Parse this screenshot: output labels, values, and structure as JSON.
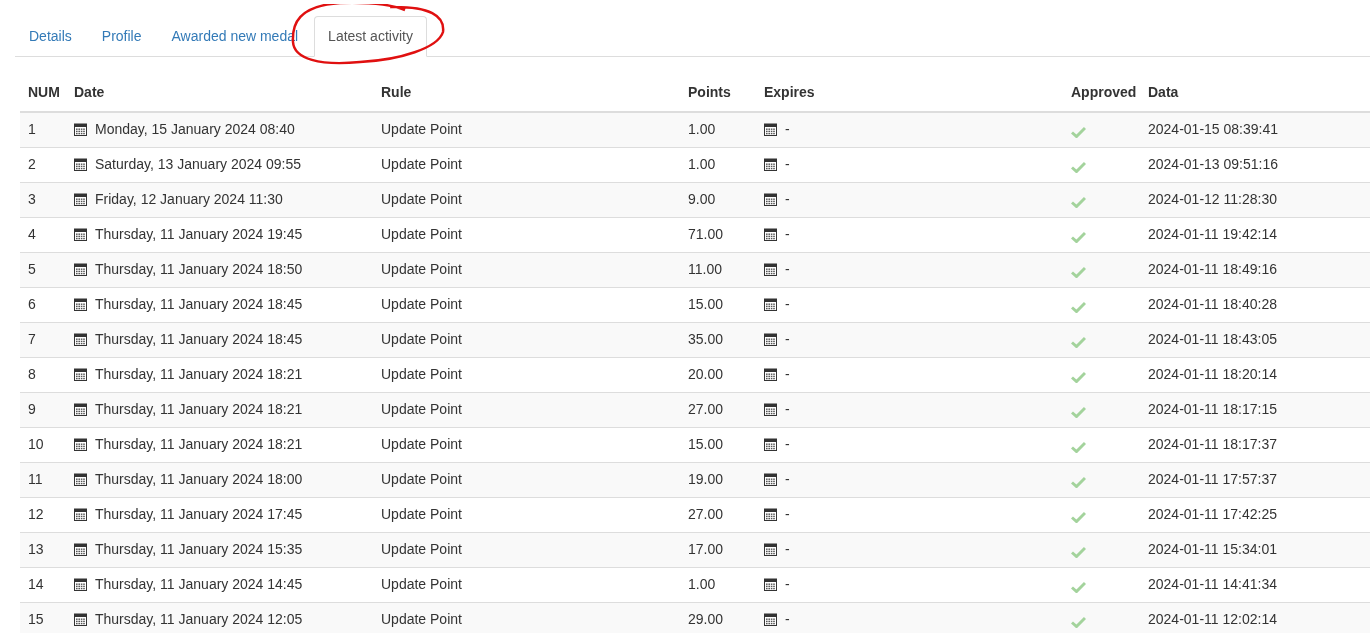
{
  "tabs": [
    {
      "label": "Details",
      "selected": false
    },
    {
      "label": "Profile",
      "selected": false
    },
    {
      "label": "Awarded new medal",
      "selected": false
    },
    {
      "label": "Latest activity",
      "selected": true
    }
  ],
  "table": {
    "columns": [
      "NUM",
      "Date",
      "Rule",
      "Points",
      "Expires",
      "Approved",
      "Data"
    ],
    "rows": [
      {
        "num": "1",
        "date": "Monday, 15 January 2024 08:40",
        "rule": "Update Point",
        "points": "1.00",
        "expires": "-",
        "approved": true,
        "data": "2024-01-15 08:39:41"
      },
      {
        "num": "2",
        "date": "Saturday, 13 January 2024 09:55",
        "rule": "Update Point",
        "points": "1.00",
        "expires": "-",
        "approved": true,
        "data": "2024-01-13 09:51:16"
      },
      {
        "num": "3",
        "date": "Friday, 12 January 2024 11:30",
        "rule": "Update Point",
        "points": "9.00",
        "expires": "-",
        "approved": true,
        "data": "2024-01-12 11:28:30"
      },
      {
        "num": "4",
        "date": "Thursday, 11 January 2024 19:45",
        "rule": "Update Point",
        "points": "71.00",
        "expires": "-",
        "approved": true,
        "data": "2024-01-11 19:42:14"
      },
      {
        "num": "5",
        "date": "Thursday, 11 January 2024 18:50",
        "rule": "Update Point",
        "points": "11.00",
        "expires": "-",
        "approved": true,
        "data": "2024-01-11 18:49:16"
      },
      {
        "num": "6",
        "date": "Thursday, 11 January 2024 18:45",
        "rule": "Update Point",
        "points": "15.00",
        "expires": "-",
        "approved": true,
        "data": "2024-01-11 18:40:28"
      },
      {
        "num": "7",
        "date": "Thursday, 11 January 2024 18:45",
        "rule": "Update Point",
        "points": "35.00",
        "expires": "-",
        "approved": true,
        "data": "2024-01-11 18:43:05"
      },
      {
        "num": "8",
        "date": "Thursday, 11 January 2024 18:21",
        "rule": "Update Point",
        "points": "20.00",
        "expires": "-",
        "approved": true,
        "data": "2024-01-11 18:20:14"
      },
      {
        "num": "9",
        "date": "Thursday, 11 January 2024 18:21",
        "rule": "Update Point",
        "points": "27.00",
        "expires": "-",
        "approved": true,
        "data": "2024-01-11 18:17:15"
      },
      {
        "num": "10",
        "date": "Thursday, 11 January 2024 18:21",
        "rule": "Update Point",
        "points": "15.00",
        "expires": "-",
        "approved": true,
        "data": "2024-01-11 18:17:37"
      },
      {
        "num": "11",
        "date": "Thursday, 11 January 2024 18:00",
        "rule": "Update Point",
        "points": "19.00",
        "expires": "-",
        "approved": true,
        "data": "2024-01-11 17:57:37"
      },
      {
        "num": "12",
        "date": "Thursday, 11 January 2024 17:45",
        "rule": "Update Point",
        "points": "27.00",
        "expires": "-",
        "approved": true,
        "data": "2024-01-11 17:42:25"
      },
      {
        "num": "13",
        "date": "Thursday, 11 January 2024 15:35",
        "rule": "Update Point",
        "points": "17.00",
        "expires": "-",
        "approved": true,
        "data": "2024-01-11 15:34:01"
      },
      {
        "num": "14",
        "date": "Thursday, 11 January 2024 14:45",
        "rule": "Update Point",
        "points": "1.00",
        "expires": "-",
        "approved": true,
        "data": "2024-01-11 14:41:34"
      },
      {
        "num": "15",
        "date": "Thursday, 11 January 2024 12:05",
        "rule": "Update Point",
        "points": "29.00",
        "expires": "-",
        "approved": true,
        "data": "2024-01-11 12:02:14"
      }
    ]
  }
}
